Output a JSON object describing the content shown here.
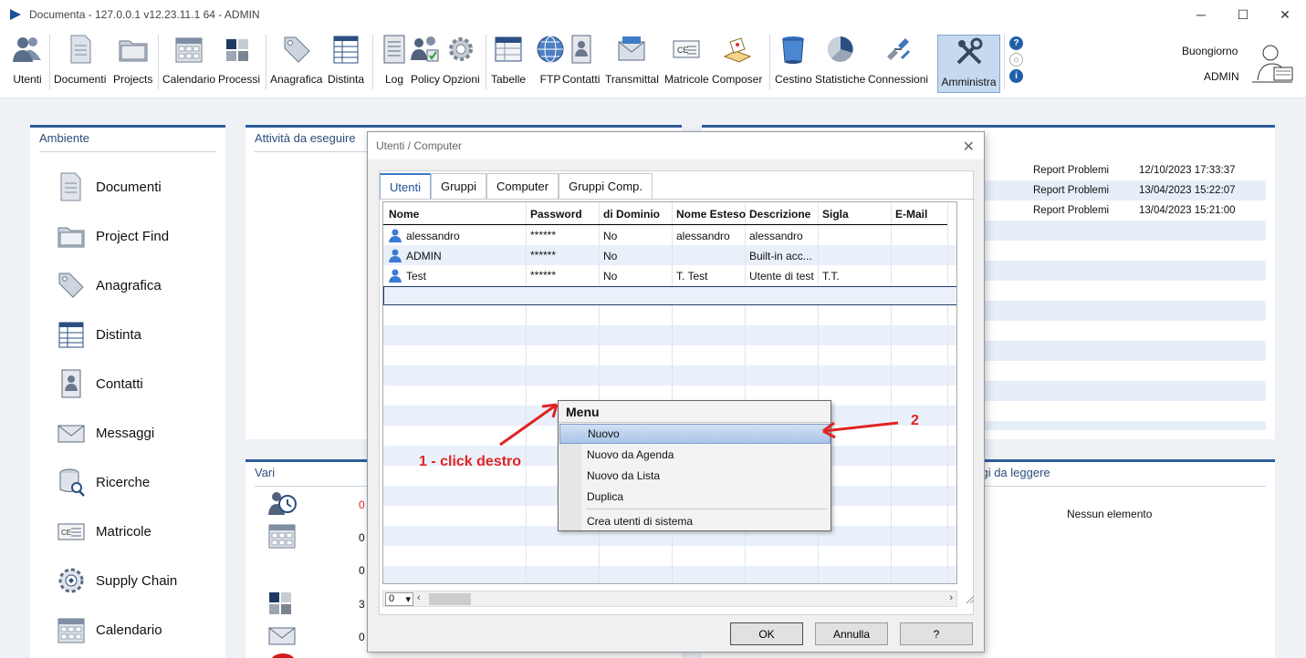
{
  "window": {
    "title": "Documenta - 127.0.0.1 v12.23.11.1 64 - ADMIN",
    "minimize": "─",
    "maximize": "☐",
    "close": "✕"
  },
  "toolbar": {
    "items": [
      {
        "label": "Utenti"
      },
      {
        "label": "Documenti"
      },
      {
        "label": "Projects"
      },
      {
        "label": "Calendario"
      },
      {
        "label": "Processi"
      },
      {
        "label": "Anagrafica"
      },
      {
        "label": "Distinta"
      },
      {
        "label": "Log"
      },
      {
        "label": "Policy"
      },
      {
        "label": "Opzioni"
      },
      {
        "label": "Tabelle"
      },
      {
        "label": "FTP"
      },
      {
        "label": "Contatti"
      },
      {
        "label": "Transmittal"
      },
      {
        "label": "Matricole"
      },
      {
        "label": "Composer"
      },
      {
        "label": "Cestino"
      },
      {
        "label": "Statistiche"
      },
      {
        "label": "Connessioni"
      },
      {
        "label": "Amministra"
      }
    ],
    "greeting": "Buongiorno",
    "user": "ADMIN"
  },
  "ambiente": {
    "title": "Ambiente",
    "items": [
      {
        "label": "Documenti"
      },
      {
        "label": "Project Find"
      },
      {
        "label": "Anagrafica"
      },
      {
        "label": "Distinta"
      },
      {
        "label": "Contatti"
      },
      {
        "label": "Messaggi"
      },
      {
        "label": "Ricerche"
      },
      {
        "label": "Matricole"
      },
      {
        "label": "Supply Chain"
      },
      {
        "label": "Calendario"
      }
    ]
  },
  "attivita": {
    "title": "Attività da eseguire"
  },
  "vari": {
    "title": "Vari",
    "values": [
      "0",
      "0",
      "0",
      "3",
      "0"
    ]
  },
  "reports": {
    "rows": [
      {
        "type": "Report Problemi",
        "date": "12/10/2023 17:33:37"
      },
      {
        "type": "Report Problemi",
        "date": "13/04/2023 15:22:07"
      },
      {
        "type": "Report Problemi",
        "date": "13/04/2023 15:21:00"
      }
    ]
  },
  "messaggi": {
    "title": "aggi da leggere",
    "empty": "Nessun elemento"
  },
  "dialog": {
    "title": "Utenti / Computer",
    "close": "✕",
    "tabs": [
      "Utenti",
      "Gruppi",
      "Computer",
      "Gruppi Comp."
    ],
    "columns": [
      "Nome",
      "Password",
      "di Dominio",
      "Nome Esteso",
      "Descrizione",
      "Sigla",
      "E-Mail"
    ],
    "rows": [
      {
        "nome": "alessandro",
        "password": "******",
        "dominio": "No",
        "esteso": "alessandro",
        "descrizione": "alessandro",
        "sigla": "",
        "email": ""
      },
      {
        "nome": "ADMIN",
        "password": "******",
        "dominio": "No",
        "esteso": "",
        "descrizione": "Built-in acc...",
        "sigla": "",
        "email": ""
      },
      {
        "nome": "Test",
        "password": "******",
        "dominio": "No",
        "esteso": "T. Test",
        "descrizione": "Utente di test",
        "sigla": "T.T.",
        "email": ""
      }
    ],
    "scroll_select": "0",
    "buttons": {
      "ok": "OK",
      "cancel": "Annulla",
      "help": "?"
    }
  },
  "context_menu": {
    "title": "Menu",
    "items": [
      "Nuovo",
      "Nuovo da Agenda",
      "Nuovo da Lista",
      "Duplica",
      "Crea utenti di sistema"
    ],
    "highlighted": "Nuovo"
  },
  "annotations": {
    "step1": "1 - click destro",
    "step2": "2",
    "color": "#e02323"
  }
}
